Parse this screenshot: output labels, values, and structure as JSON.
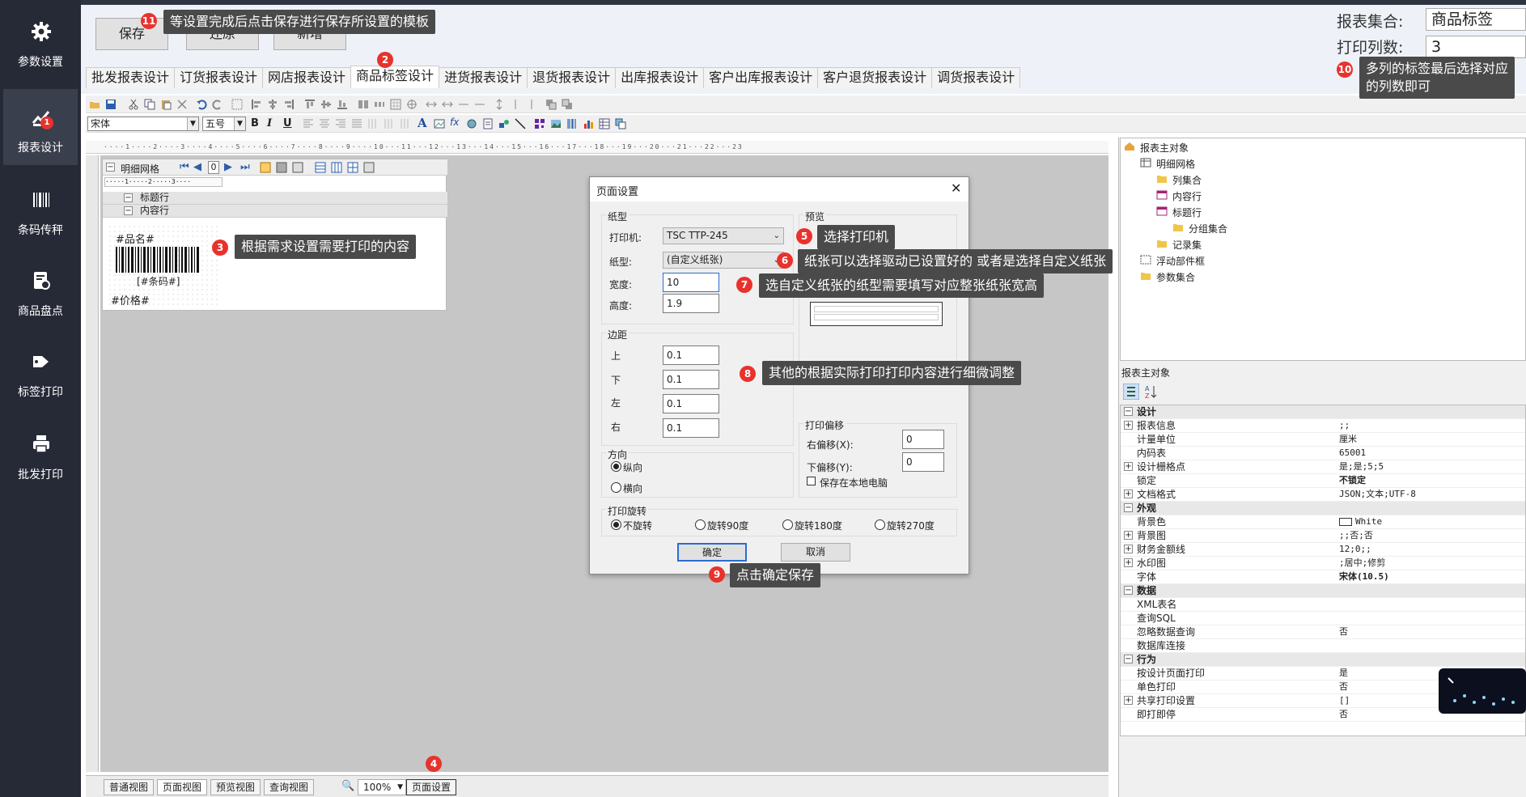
{
  "sidebar": {
    "items": [
      {
        "label": "参数设置",
        "icon": "gear-icon"
      },
      {
        "label": "报表设计",
        "icon": "chart-pen-icon",
        "badge": "1"
      },
      {
        "label": "条码传秤",
        "icon": "barcode-icon"
      },
      {
        "label": "商品盘点",
        "icon": "inventory-icon"
      },
      {
        "label": "标签打印",
        "icon": "tag-icon"
      },
      {
        "label": "批发打印",
        "icon": "printer-icon"
      }
    ]
  },
  "toolbar": {
    "save_label": "保存",
    "restore_label": "还原",
    "new_label": "新增"
  },
  "tabs": [
    "批发报表设计",
    "订货报表设计",
    "网店报表设计",
    "商品标签设计",
    "进货报表设计",
    "退货报表设计",
    "出库报表设计",
    "客户出库报表设计",
    "客户退货报表设计",
    "调货报表设计"
  ],
  "report_set": {
    "label": "报表集合:",
    "value": "商品标签"
  },
  "print_cols": {
    "label": "打印列数:",
    "value": "3"
  },
  "format_bar": {
    "font": "宋体",
    "size": "五号"
  },
  "ruler_text": "····1····2····3····4····5····6····7····8····9····10···11···12···13···14···15···16···17···18···19···20···21···22···23",
  "grid": {
    "title": "明细网格",
    "page": "0",
    "bands": [
      "标题行",
      "内容行"
    ],
    "fields": {
      "name": "#品名#",
      "barcode": "[#条码#]",
      "price": "#价格#"
    }
  },
  "dialog": {
    "title": "页面设置",
    "paper_group": "纸型",
    "printer_label": "打印机:",
    "printer_value": "TSC TTP-245",
    "paper_label": "纸型:",
    "paper_value": "(自定义纸张)",
    "width_label": "宽度:",
    "width_value": "10",
    "height_label": "高度:",
    "height_value": "1.9",
    "preview_group": "预览",
    "margin_group": "边距",
    "top_label": "上",
    "top_value": "0.1",
    "bottom_label": "下",
    "bottom_value": "0.1",
    "left_label": "左",
    "left_value": "0.1",
    "right_label": "右",
    "right_value": "0.1",
    "orient_group": "方向",
    "portrait": "纵向",
    "landscape": "横向",
    "offset_group": "打印偏移",
    "offset_x_label": "右偏移(X):",
    "offset_x_value": "0",
    "offset_y_label": "下偏移(Y):",
    "offset_y_value": "0",
    "save_local": "保存在本地电脑",
    "rotate_group": "打印旋转",
    "rot0": "不旋转",
    "rot90": "旋转90度",
    "rot180": "旋转180度",
    "rot270": "旋转270度",
    "ok": "确定",
    "cancel": "取消"
  },
  "callouts": {
    "c11": {
      "num": "11",
      "text": "等设置完成后点击保存进行保存所设置的模板"
    },
    "c2": {
      "num": "2"
    },
    "c10": {
      "num": "10",
      "line1": "多列的标签最后选择对应",
      "line2": "的列数即可"
    },
    "c3": {
      "num": "3",
      "text": "根据需求设置需要打印的内容"
    },
    "c5": {
      "num": "5",
      "text": "选择打印机"
    },
    "c6": {
      "num": "6",
      "text": "纸张可以选择驱动已设置好的 或者是选择自定义纸张"
    },
    "c7": {
      "num": "7",
      "text": "选自定义纸张的纸型需要填写对应整张纸张宽高"
    },
    "c8": {
      "num": "8",
      "text": "其他的根据实际打印打印内容进行细微调整"
    },
    "c9": {
      "num": "9",
      "text": "点击确定保存"
    },
    "c4": {
      "num": "4"
    }
  },
  "tree": {
    "root": "报表主对象",
    "items": [
      "明细网格",
      "列集合",
      "内容行",
      "标题行",
      "分组集合",
      "记录集",
      "浮动部件框",
      "参数集合"
    ]
  },
  "props": {
    "header": "报表主对象",
    "rows": [
      {
        "cat": true,
        "name": "设计"
      },
      {
        "name": "报表信息",
        "value": ";;",
        "exp": true
      },
      {
        "name": "计量单位",
        "value": "厘米"
      },
      {
        "name": "内码表",
        "value": "65001"
      },
      {
        "name": "设计栅格点",
        "value": "是;是;5;5",
        "exp": true
      },
      {
        "name": "锁定",
        "value": "不锁定",
        "bold": true
      },
      {
        "name": "文档格式",
        "value": "JSON;文本;UTF-8",
        "exp": true
      },
      {
        "cat": true,
        "name": "外观"
      },
      {
        "name": "背景色",
        "value": "White",
        "swatch": true
      },
      {
        "name": "背景图",
        "value": ";;否;否",
        "exp": true
      },
      {
        "name": "财务金额线",
        "value": "12;0;;",
        "exp": true
      },
      {
        "name": "水印图",
        "value": ";居中;修剪",
        "exp": true
      },
      {
        "name": "字体",
        "value": "宋体(10.5)",
        "bold": true
      },
      {
        "cat": true,
        "name": "数据"
      },
      {
        "name": "XML表名",
        "value": ""
      },
      {
        "name": "查询SQL",
        "value": ""
      },
      {
        "name": "忽略数据查询",
        "value": "否"
      },
      {
        "name": "数据库连接",
        "value": ""
      },
      {
        "cat": true,
        "name": "行为"
      },
      {
        "name": "按设计页面打印",
        "value": "是"
      },
      {
        "name": "单色打印",
        "value": "否"
      },
      {
        "name": "共享打印设置",
        "value": "[]",
        "exp": true
      },
      {
        "name": "即打即停",
        "value": "否"
      }
    ]
  },
  "status": {
    "views": [
      "普通视图",
      "页面视图",
      "预览视图",
      "查询视图"
    ],
    "zoom": "100%",
    "page_setup": "页面设置"
  },
  "colors": {
    "sidebar": "#262a36",
    "callout": "#4a4a4a",
    "badge": "#e8322c"
  }
}
